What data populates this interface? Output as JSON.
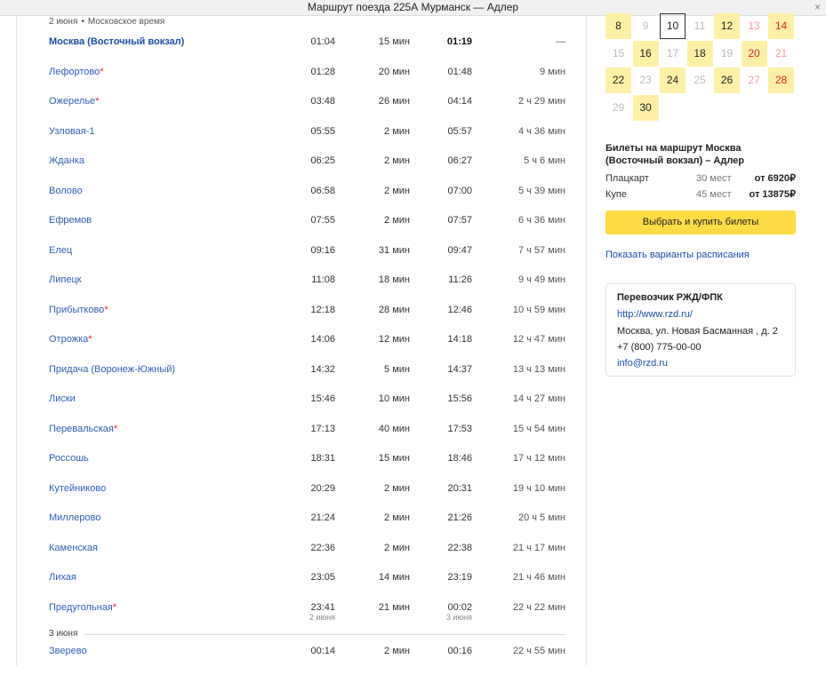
{
  "window": {
    "title": "Маршрут поезда 225А Мурманск — Адлер",
    "close": "×"
  },
  "schedule": {
    "date_label": "2 июня",
    "timezone": "Московское время",
    "rows": [
      {
        "station": "Москва (Восточный вокзал)",
        "star": "",
        "arrival": "01:04",
        "stop": "15 мин",
        "departure": "01:19",
        "travel": "—",
        "first": true
      },
      {
        "station": "Лефортово",
        "star": "*",
        "arrival": "01:28",
        "stop": "20 мин",
        "departure": "01:48",
        "travel": "9 мин"
      },
      {
        "station": "Ожерелье",
        "star": "*",
        "arrival": "03:48",
        "stop": "26 мин",
        "departure": "04:14",
        "travel": "2 ч 29 мин"
      },
      {
        "station": "Узловая-1",
        "star": "",
        "arrival": "05:55",
        "stop": "2 мин",
        "departure": "05:57",
        "travel": "4 ч 36 мин"
      },
      {
        "station": "Жданка",
        "star": "",
        "arrival": "06:25",
        "stop": "2 мин",
        "departure": "06:27",
        "travel": "5 ч 6 мин"
      },
      {
        "station": "Волово",
        "star": "",
        "arrival": "06:58",
        "stop": "2 мин",
        "departure": "07:00",
        "travel": "5 ч 39 мин"
      },
      {
        "station": "Ефремов",
        "star": "",
        "arrival": "07:55",
        "stop": "2 мин",
        "departure": "07:57",
        "travel": "6 ч 36 мин"
      },
      {
        "station": "Елец",
        "star": "",
        "arrival": "09:16",
        "stop": "31 мин",
        "departure": "09:47",
        "travel": "7 ч 57 мин"
      },
      {
        "station": "Липецк",
        "star": "",
        "arrival": "11:08",
        "stop": "18 мин",
        "departure": "11:26",
        "travel": "9 ч 49 мин"
      },
      {
        "station": "Прибытково",
        "star": "*",
        "arrival": "12:18",
        "stop": "28 мин",
        "departure": "12:46",
        "travel": "10 ч 59 мин"
      },
      {
        "station": "Отрожка",
        "star": "*",
        "arrival": "14:06",
        "stop": "12 мин",
        "departure": "14:18",
        "travel": "12 ч 47 мин"
      },
      {
        "station": "Придача (Воронеж-Южный)",
        "star": "",
        "arrival": "14:32",
        "stop": "5 мин",
        "departure": "14:37",
        "travel": "13 ч 13 мин"
      },
      {
        "station": "Лиски",
        "star": "",
        "arrival": "15:46",
        "stop": "10 мин",
        "departure": "15:56",
        "travel": "14 ч 27 мин"
      },
      {
        "station": "Перевальская",
        "star": "*",
        "arrival": "17:13",
        "stop": "40 мин",
        "departure": "17:53",
        "travel": "15 ч 54 мин"
      },
      {
        "station": "Россошь",
        "star": "",
        "arrival": "18:31",
        "stop": "15 мин",
        "departure": "18:46",
        "travel": "17 ч 12 мин"
      },
      {
        "station": "Кутейниково",
        "star": "",
        "arrival": "20:29",
        "stop": "2 мин",
        "departure": "20:31",
        "travel": "19 ч 10 мин"
      },
      {
        "station": "Миллерово",
        "star": "",
        "arrival": "21:24",
        "stop": "2 мин",
        "departure": "21:26",
        "travel": "20 ч 5 мин"
      },
      {
        "station": "Каменская",
        "star": "",
        "arrival": "22:36",
        "stop": "2 мин",
        "departure": "22:38",
        "travel": "21 ч 17 мин"
      },
      {
        "station": "Лихая",
        "star": "",
        "arrival": "23:05",
        "stop": "14 мин",
        "departure": "23:19",
        "travel": "21 ч 46 мин"
      },
      {
        "station": "Предугольная",
        "star": "*",
        "arrival": "23:41",
        "arrival_date": "2 июня",
        "stop": "21 мин",
        "departure": "00:02",
        "departure_date": "3 июня",
        "travel": "22 ч 22 мин"
      }
    ],
    "separator_label": "3 июня",
    "last_row": {
      "station": "Зверево",
      "star": "",
      "arrival": "00:14",
      "stop": "2 мин",
      "departure": "00:16",
      "travel": "22 ч 55 мин"
    }
  },
  "calendar": {
    "rows": [
      [
        {
          "d": "8",
          "s": "y"
        },
        {
          "d": "9",
          "s": "dim"
        },
        {
          "d": "10",
          "s": "sel"
        },
        {
          "d": "11",
          "s": "dim"
        },
        {
          "d": "12",
          "s": "y"
        },
        {
          "d": "13",
          "s": "redl"
        },
        {
          "d": "14",
          "s": "y red"
        }
      ],
      [
        {
          "d": "15",
          "s": "dim"
        },
        {
          "d": "16",
          "s": "y"
        },
        {
          "d": "17",
          "s": "dim"
        },
        {
          "d": "18",
          "s": "y"
        },
        {
          "d": "19",
          "s": "dim"
        },
        {
          "d": "20",
          "s": "y red"
        },
        {
          "d": "21",
          "s": "redl"
        }
      ],
      [
        {
          "d": "22",
          "s": "y"
        },
        {
          "d": "23",
          "s": "dim"
        },
        {
          "d": "24",
          "s": "y"
        },
        {
          "d": "25",
          "s": "dim"
        },
        {
          "d": "26",
          "s": "y"
        },
        {
          "d": "27",
          "s": "redl"
        },
        {
          "d": "28",
          "s": "y red"
        }
      ],
      [
        {
          "d": "29",
          "s": "dim"
        },
        {
          "d": "30",
          "s": "y"
        }
      ]
    ]
  },
  "tickets": {
    "title": "Билеты на маршрут Москва (Восточный вокзал) – Адлер",
    "classes": [
      {
        "name": "Плацкарт",
        "seats": "30 мест",
        "price": "от 6920₽"
      },
      {
        "name": "Купе",
        "seats": "45 мест",
        "price": "от 13875₽"
      }
    ],
    "buy_label": "Выбрать и купить билеты",
    "variants_link": "Показать варианты расписания"
  },
  "carrier": {
    "title": "Перевозчик РЖД/ФПК",
    "url": "http://www.rzd.ru/",
    "address": "Москва, ул. Новая Басманная , д. 2",
    "phone": "+7 (800) 775-00-00",
    "email": "info@rzd.ru"
  }
}
